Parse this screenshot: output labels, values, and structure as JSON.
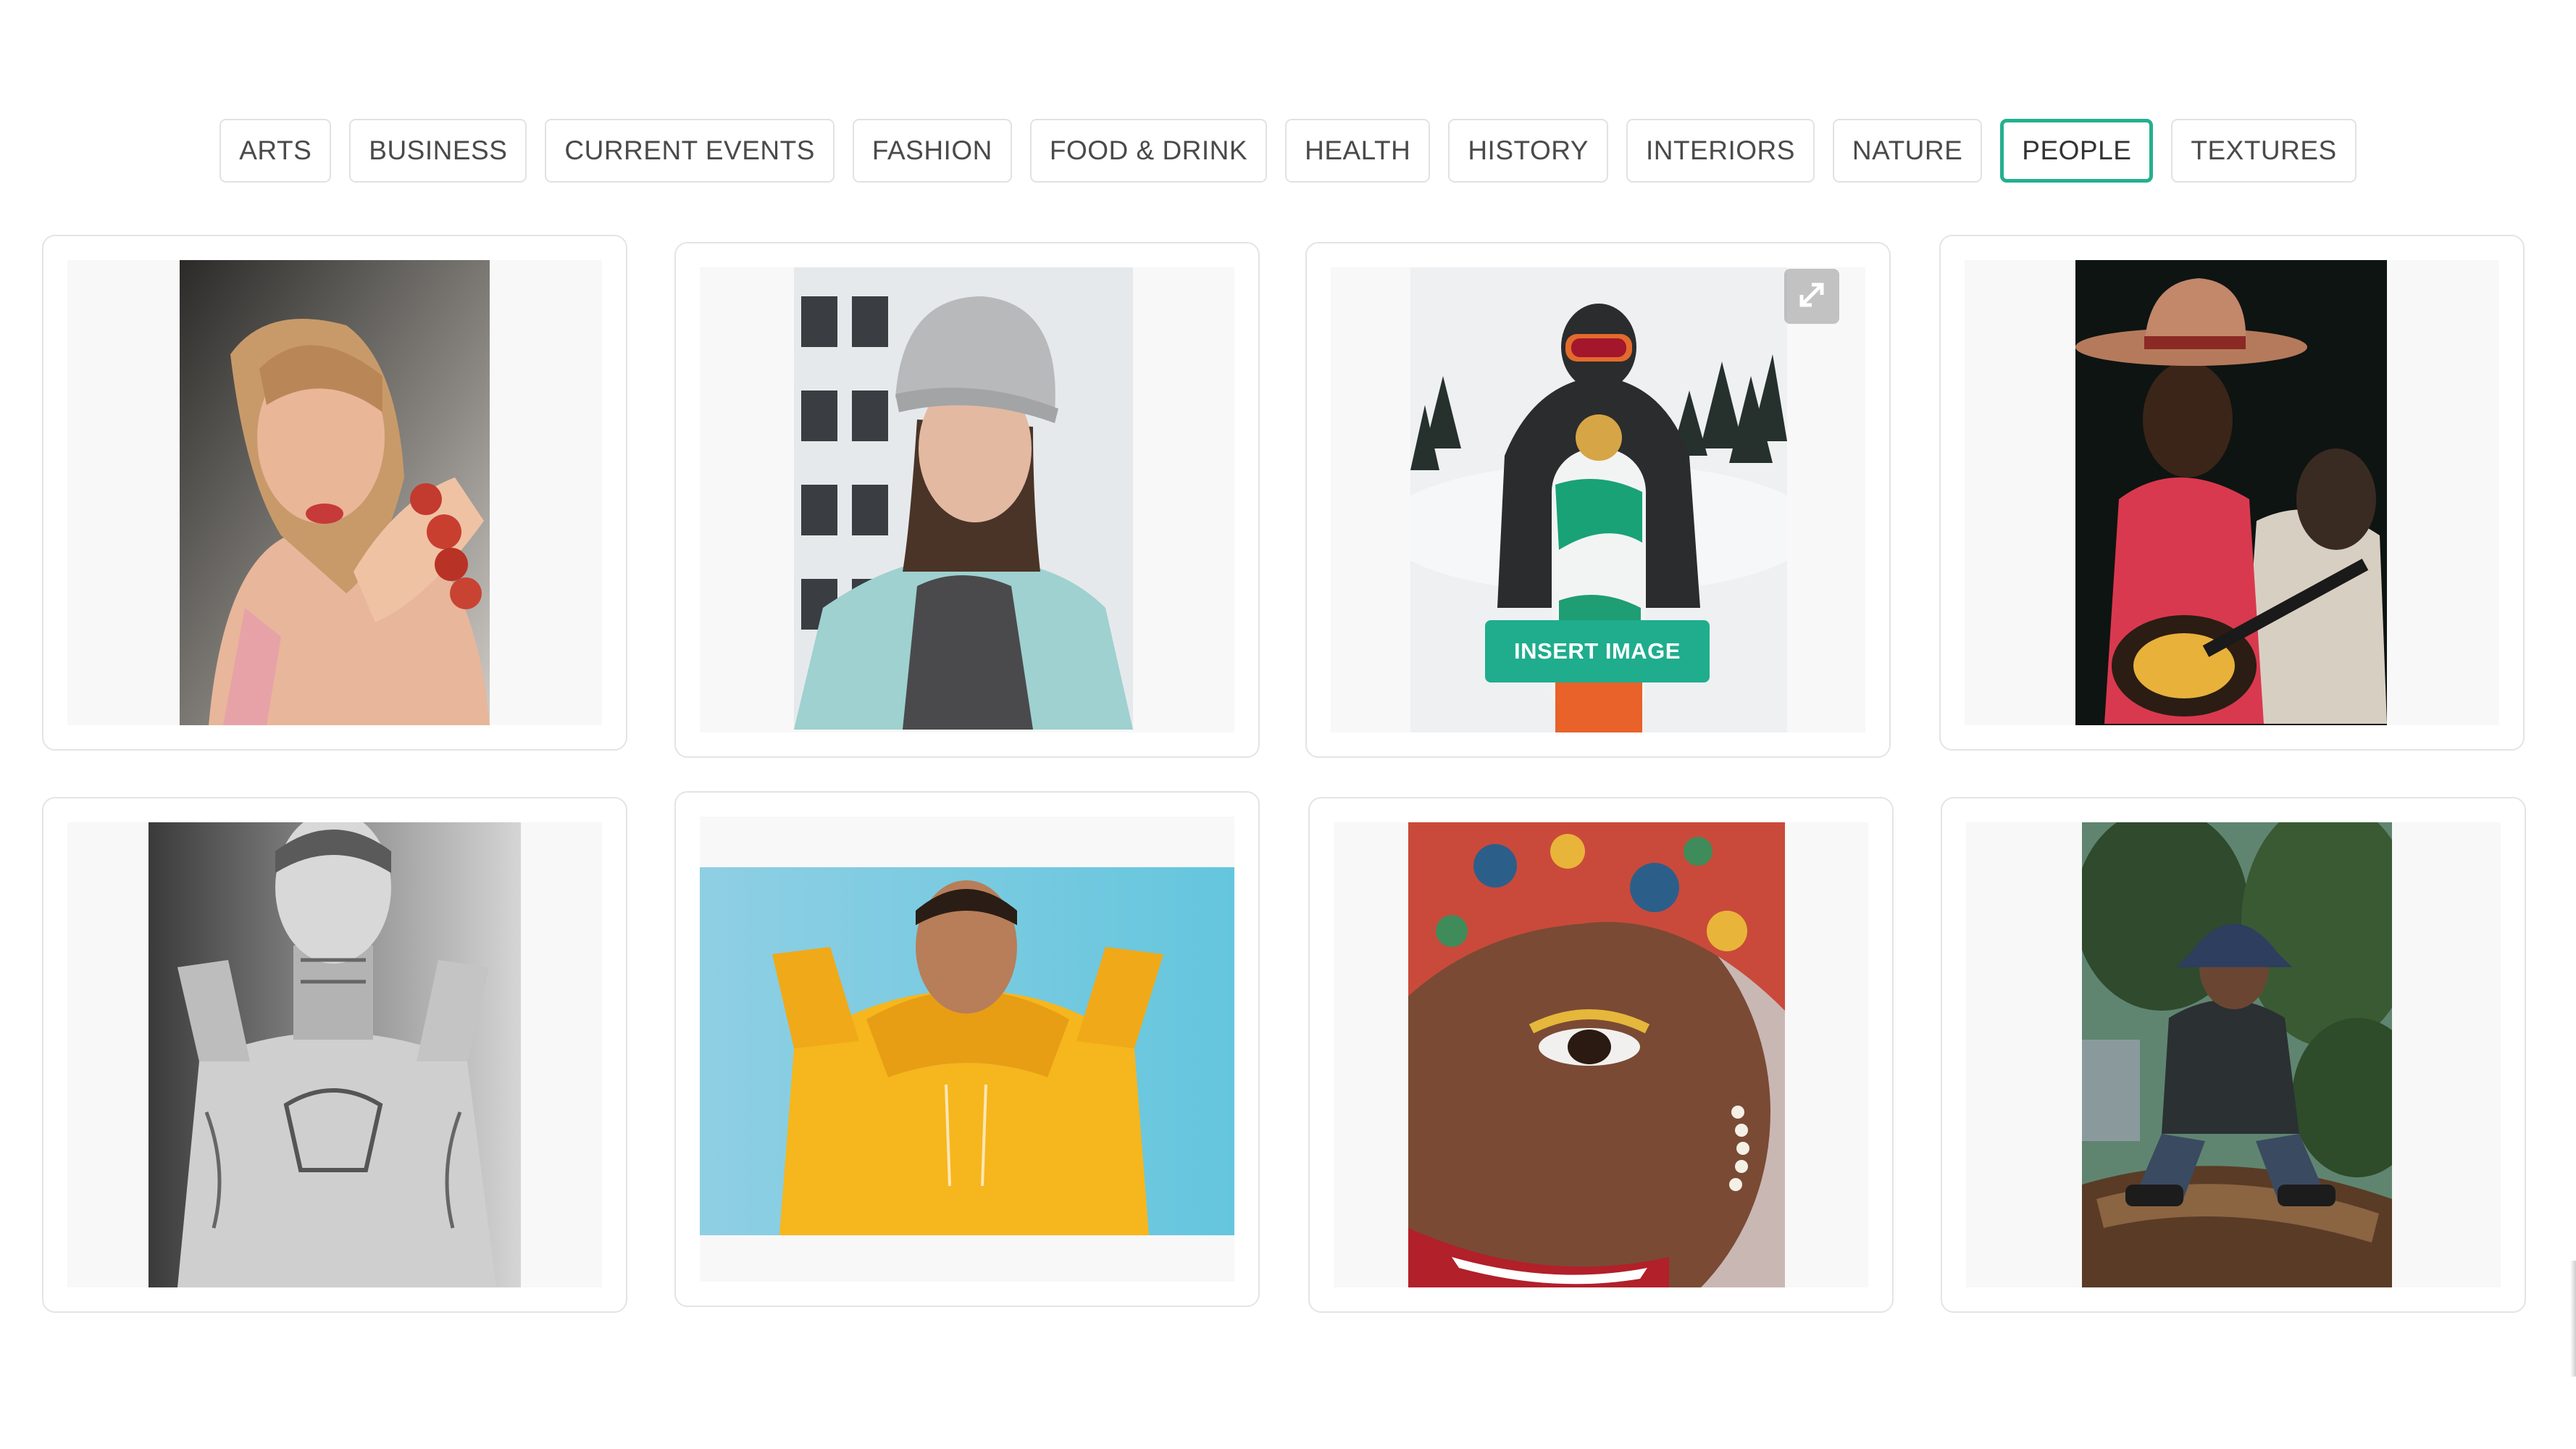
{
  "categories": [
    {
      "label": "ARTS"
    },
    {
      "label": "BUSINESS"
    },
    {
      "label": "CURRENT EVENTS"
    },
    {
      "label": "FASHION"
    },
    {
      "label": "FOOD & DRINK"
    },
    {
      "label": "HEALTH"
    },
    {
      "label": "HISTORY"
    },
    {
      "label": "INTERIORS"
    },
    {
      "label": "NATURE"
    },
    {
      "label": "PEOPLE"
    },
    {
      "label": "TEXTURES"
    }
  ],
  "active_category": "PEOPLE",
  "hover_card": {
    "insert_label": "INSERT IMAGE",
    "expand_icon": "expand-icon"
  },
  "colors": {
    "accent": "#23b08f",
    "insert_button": "#1fad8d"
  }
}
